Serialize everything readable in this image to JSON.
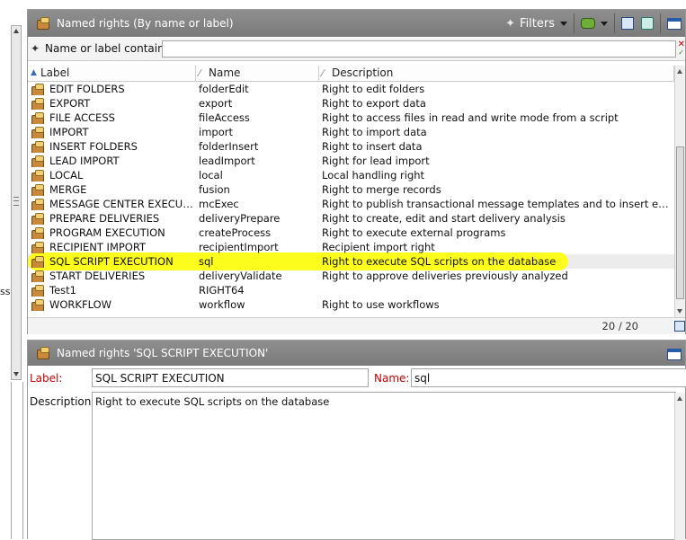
{
  "left_edge_text": "ss",
  "list_panel": {
    "title": "Named rights (By name or label)",
    "filters_label": "Filters",
    "filter_label": "Name or label contains:",
    "filter_value": "",
    "columns": [
      "Label",
      "Name",
      "Description"
    ],
    "rows": [
      {
        "label": "EDIT FOLDERS",
        "name": "folderEdit",
        "description": "Right to edit folders"
      },
      {
        "label": "EXPORT",
        "name": "export",
        "description": "Right to export data"
      },
      {
        "label": "FILE ACCESS",
        "name": "fileAccess",
        "description": "Right to access files in read and write mode from a script"
      },
      {
        "label": "IMPORT",
        "name": "import",
        "description": "Right to import data"
      },
      {
        "label": "INSERT FOLDERS",
        "name": "folderInsert",
        "description": "Right to insert data"
      },
      {
        "label": "LEAD IMPORT",
        "name": "leadImport",
        "description": "Right for lead import"
      },
      {
        "label": "LOCAL",
        "name": "local",
        "description": "Local handling right"
      },
      {
        "label": "MERGE",
        "name": "fusion",
        "description": "Right to merge records"
      },
      {
        "label": "MESSAGE CENTER EXECUTION",
        "name": "mcExec",
        "description": "Right to publish transactional message templates and to insert events in..."
      },
      {
        "label": "PREPARE DELIVERIES",
        "name": "deliveryPrepare",
        "description": "Right to create, edit and start delivery analysis"
      },
      {
        "label": "PROGRAM EXECUTION",
        "name": "createProcess",
        "description": "Right to execute external programs"
      },
      {
        "label": "RECIPIENT IMPORT",
        "name": "recipientImport",
        "description": "Recipient import right"
      },
      {
        "label": "SQL SCRIPT EXECUTION",
        "name": "sql",
        "description": "Right to execute SQL scripts on the database",
        "selected": true
      },
      {
        "label": "START DELIVERIES",
        "name": "deliveryValidate",
        "description": "Right to approve deliveries previously analyzed"
      },
      {
        "label": "Test1",
        "name": "RIGHT64",
        "description": ""
      },
      {
        "label": "WORKFLOW",
        "name": "workflow",
        "description": "Right to use workflows"
      }
    ],
    "count": "20 / 20"
  },
  "detail_panel": {
    "title": "Named rights 'SQL SCRIPT EXECUTION'",
    "label_caption": "Label:",
    "label_value": "SQL SCRIPT EXECUTION",
    "name_caption": "Name:",
    "name_value": "sql",
    "description_caption": "Description:",
    "description_value": "Right to execute SQL scripts on the database"
  },
  "colors": {
    "titlebar": "#858585",
    "highlight": "#ffff00",
    "required_label": "#c00000"
  },
  "icons": [
    "named-right-icon",
    "filter-icon",
    "binoculars-icon",
    "new-icon",
    "refresh-icon",
    "window-icon"
  ]
}
